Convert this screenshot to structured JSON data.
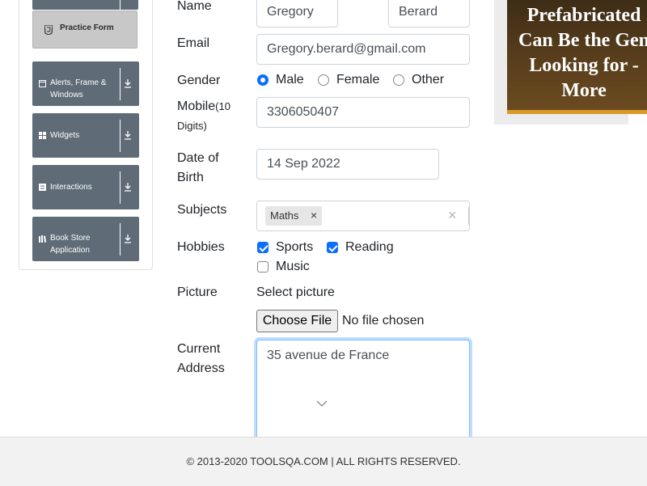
{
  "sidebar": {
    "practice_form": {
      "label": "Practice Form",
      "icon": "html5-icon"
    },
    "groups": [
      {
        "label": "Alerts, Frame & Windows",
        "icon": "window-icon"
      },
      {
        "label": "Widgets",
        "icon": "grid-icon"
      },
      {
        "label": "Interactions",
        "icon": "interactions-icon"
      },
      {
        "label": "Book Store Application",
        "icon": "book-icon"
      }
    ]
  },
  "form": {
    "name": {
      "label": "Name",
      "first": "Gregory",
      "last": "Berard"
    },
    "email": {
      "label": "Email",
      "value": "Gregory.berard@gmail.com"
    },
    "gender": {
      "label": "Gender",
      "options": [
        "Male",
        "Female",
        "Other"
      ],
      "selected": "Male"
    },
    "mobile": {
      "label": "Mobile",
      "hint": "(10 Digits)",
      "value": "3306050407"
    },
    "dob": {
      "label_line1": "Date of",
      "label_line2": "Birth",
      "value": "14 Sep 2022"
    },
    "subjects": {
      "label": "Subjects",
      "chips": [
        "Maths"
      ],
      "remove_glyph": "×",
      "clear_glyph": "×"
    },
    "hobbies": {
      "label": "Hobbies",
      "options": [
        "Sports",
        "Reading",
        "Music"
      ],
      "checked": [
        "Sports",
        "Reading"
      ]
    },
    "picture": {
      "label": "Picture",
      "prompt": "Select picture",
      "button": "Choose File",
      "status": "No file chosen"
    },
    "address": {
      "label_line1": "Current",
      "label_line2": "Address",
      "value": "35 avenue de France"
    }
  },
  "ad": {
    "lines": [
      "Prefabricated",
      "Can Be the Gen",
      "Looking for -",
      "More"
    ]
  },
  "footer": {
    "text": "© 2013-2020 TOOLSQA.COM | ALL RIGHTS RESERVED."
  },
  "colors": {
    "accent": "#0d6efd",
    "sidebar_group": "#5f6b77",
    "ad_border": "#d99a28"
  }
}
